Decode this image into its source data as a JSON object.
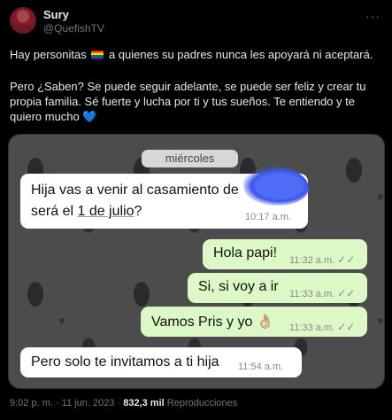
{
  "author": {
    "name": "Sury",
    "handle": "@QuefishTV"
  },
  "tweet": {
    "line1_before": "Hay personitas",
    "line1_after": "a quienes su padres  nunca les apoyará ni aceptará.",
    "line2": "Pero ¿Saben? Se puede seguir adelante, se puede ser feliz y crear tu",
    "line3": "propia familia. Sé fuerte y lucha por ti y tus sueños. Te entiendo y te",
    "line4": "quiero mucho",
    "heart": "💙",
    "more": "···"
  },
  "chat": {
    "date_label": "miércoles",
    "messages": [
      {
        "direction": "in",
        "line1": "Hija vas a venir al casamiento de",
        "line2_a": "será el ",
        "line2_b": "1 de julio",
        "line2_c": "?",
        "time": "10:17 a.m."
      },
      {
        "direction": "out",
        "text": "Hola papi!",
        "time": "11:32 a.m."
      },
      {
        "direction": "out",
        "text": "Si, si voy a ir",
        "time": "11:33 a.m."
      },
      {
        "direction": "out",
        "text": "Vamos Pris y yo 👌🏼",
        "time": "11:33 a.m."
      },
      {
        "direction": "in",
        "text": "Pero solo te invitamos a ti hija",
        "time": "11:54 a.m."
      }
    ],
    "read_ticks": "✓✓"
  },
  "footer": {
    "timestamp": "9:02 p. m. · 11 jun. 2023 ·",
    "views_count": "832,3 mil",
    "views_label": "Reproducciones"
  }
}
